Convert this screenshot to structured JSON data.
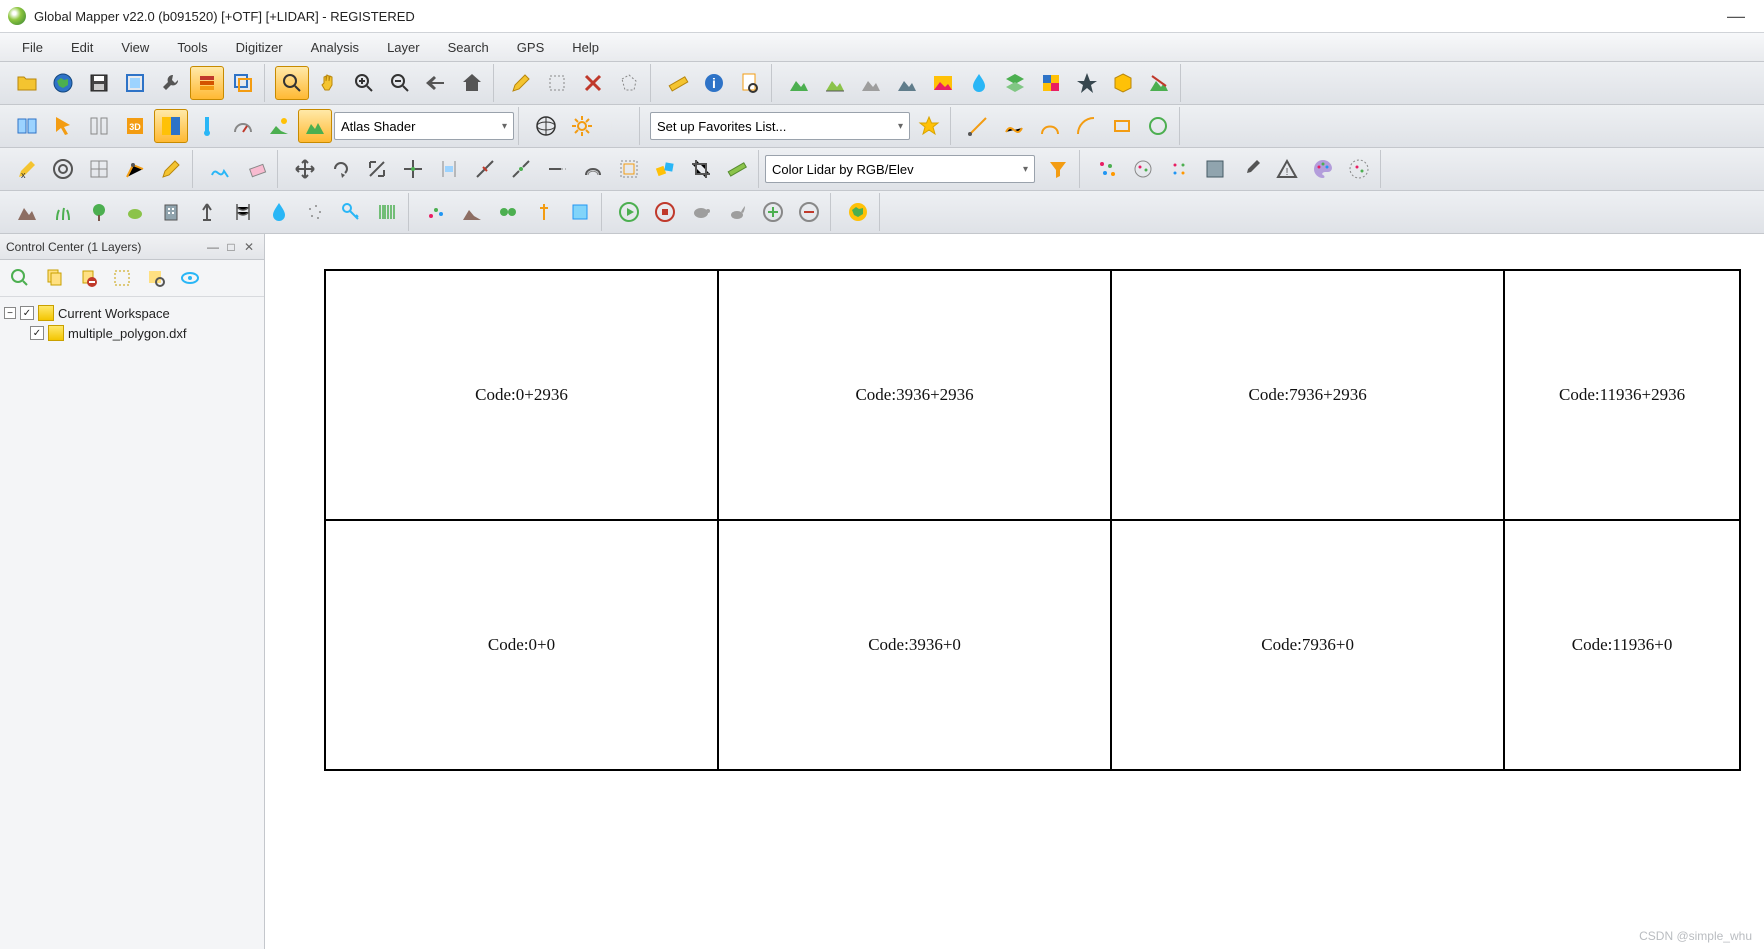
{
  "app": {
    "title": "Global Mapper v22.0 (b091520) [+OTF] [+LIDAR] - REGISTERED"
  },
  "menu": {
    "file": "File",
    "edit": "Edit",
    "view": "View",
    "tools": "Tools",
    "digitizer": "Digitizer",
    "analysis": "Analysis",
    "layer": "Layer",
    "search": "Search",
    "gps": "GPS",
    "help": "Help"
  },
  "combo": {
    "shader": "Atlas Shader",
    "favorites": "Set up Favorites List...",
    "lidar": "Color Lidar by RGB/Elev"
  },
  "panel": {
    "title": "Control Center (1 Layers)",
    "root": "Current Workspace",
    "layer": "multiple_polygon.dxf"
  },
  "cells": {
    "r0c0": "Code:0+2936",
    "r0c1": "Code:3936+2936",
    "r0c2": "Code:7936+2936",
    "r0c3": "Code:11936+2936",
    "r1c0": "Code:0+0",
    "r1c1": "Code:3936+0",
    "r1c2": "Code:7936+0",
    "r1c3": "Code:11936+0"
  },
  "watermark": "CSDN @simple_whu"
}
